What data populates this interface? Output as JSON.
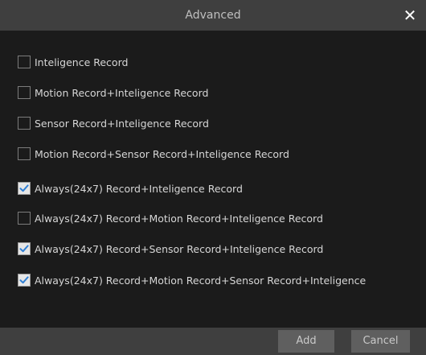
{
  "dialog": {
    "title": "Advanced",
    "close_icon": "close-icon"
  },
  "options": [
    {
      "label": "Inteligence Record",
      "checked": false
    },
    {
      "label": "Motion Record+Inteligence Record",
      "checked": false
    },
    {
      "label": "Sensor Record+Inteligence Record",
      "checked": false
    },
    {
      "label": "Motion Record+Sensor Record+Inteligence Record",
      "checked": false
    },
    {
      "label": "Always(24x7) Record+Inteligence Record",
      "checked": true
    },
    {
      "label": "Always(24x7) Record+Motion Record+Inteligence Record",
      "checked": false
    },
    {
      "label": "Always(24x7) Record+Sensor Record+Inteligence Record",
      "checked": true
    },
    {
      "label": "Always(24x7) Record+Motion Record+Sensor Record+Inteligence",
      "checked": true
    }
  ],
  "footer": {
    "add_label": "Add",
    "cancel_label": "Cancel"
  },
  "colors": {
    "background": "#1b1b1b",
    "bar": "#3f3f3f",
    "check_accent": "#2f7fd4"
  }
}
